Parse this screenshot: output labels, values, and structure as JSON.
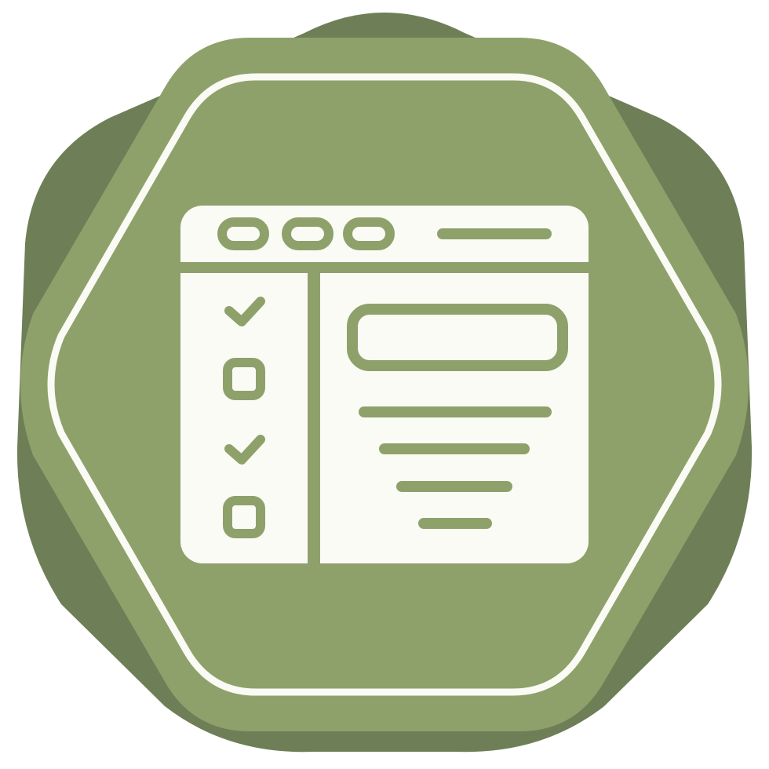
{
  "icon": {
    "name": "browser-checklist-icon",
    "colors": {
      "badge_dark": "#6e7f57",
      "badge_light": "#8ea16b",
      "foreground": "#fbfbf5",
      "stroke": "#8ea16b"
    },
    "checklist": [
      {
        "state": "checked"
      },
      {
        "state": "unchecked"
      },
      {
        "state": "checked"
      },
      {
        "state": "unchecked"
      }
    ],
    "window_controls": 3
  }
}
